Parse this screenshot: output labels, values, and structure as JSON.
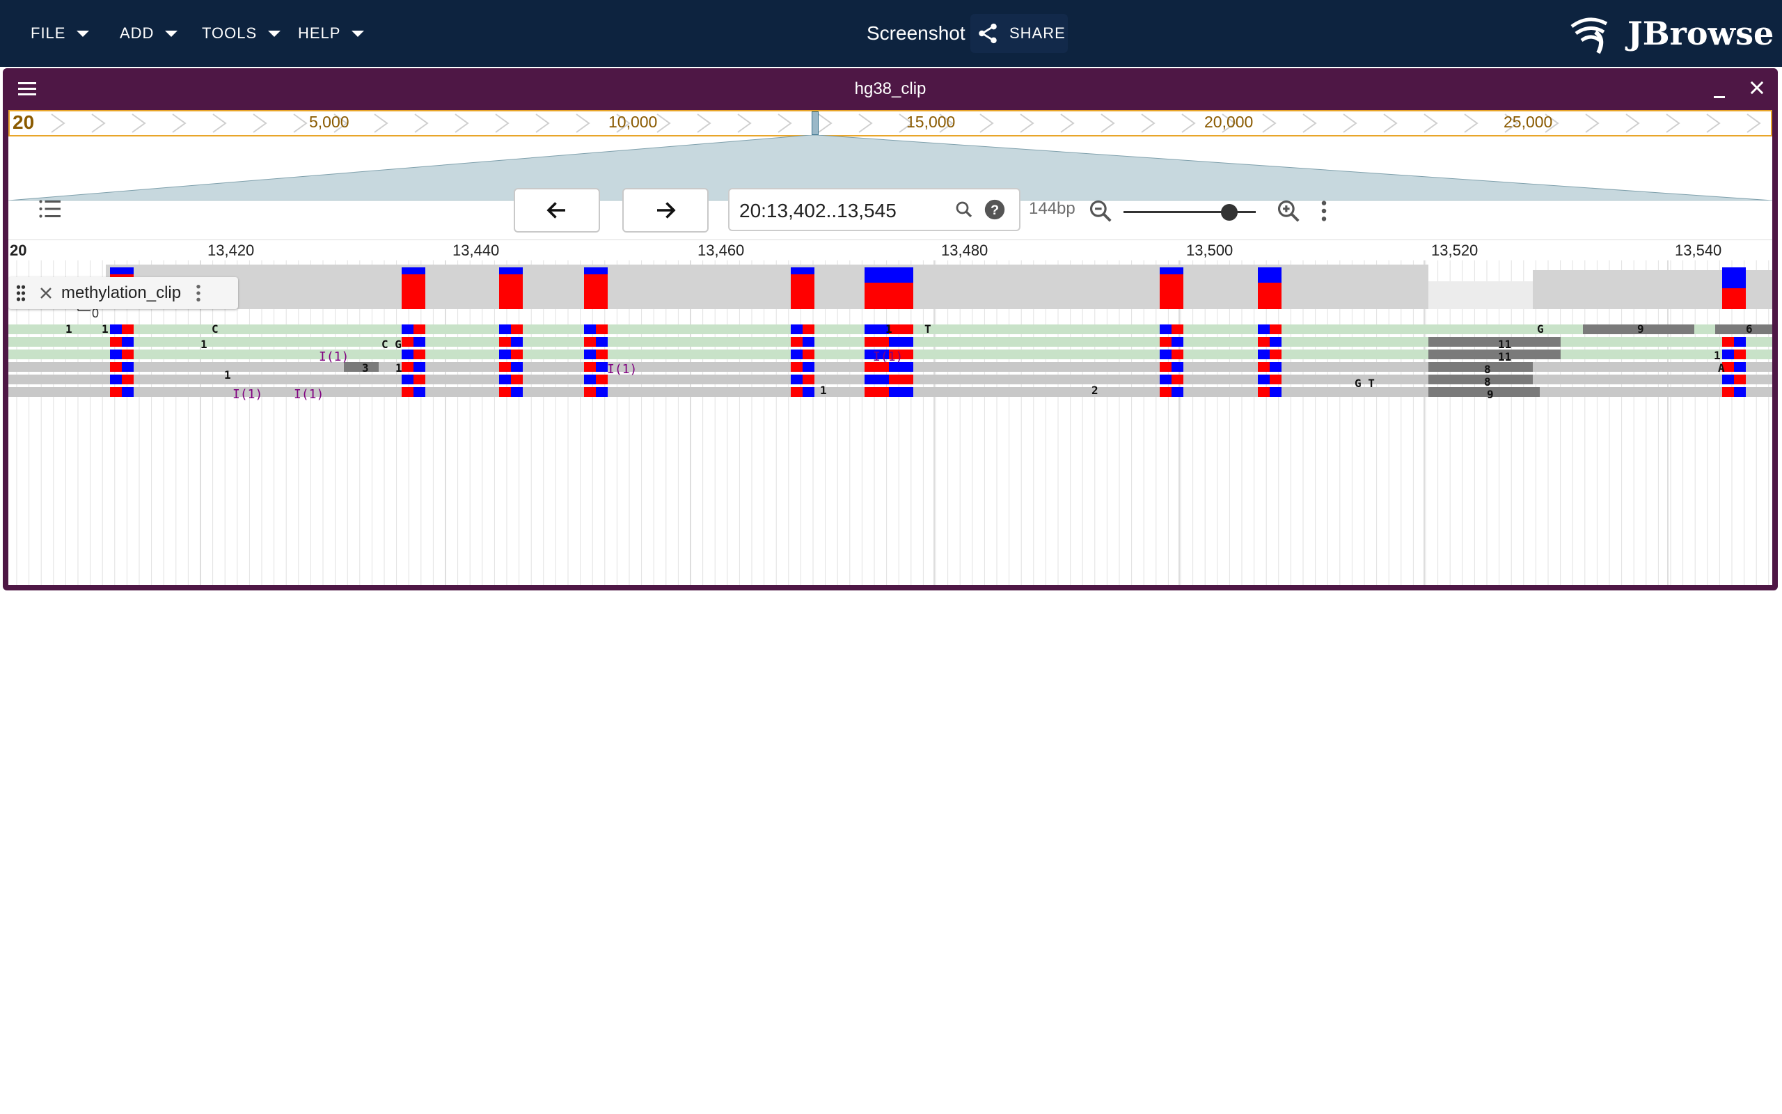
{
  "appbar": {
    "menus": [
      {
        "label": "FILE"
      },
      {
        "label": "ADD"
      },
      {
        "label": "TOOLS"
      },
      {
        "label": "HELP"
      }
    ],
    "session_title": "Screenshot",
    "share_label": "SHARE",
    "logo_text": "JBrowse"
  },
  "view": {
    "title": "hg38_clip",
    "overview": {
      "chromosome": "20",
      "labels": [
        "5,000",
        "10,000",
        "15,000",
        "20,000",
        "25,000"
      ]
    },
    "nav": {
      "location": "20:13,402..13,545",
      "bp_label": "144bp",
      "zoom_level": 0.78
    },
    "ruler": {
      "chromosome": "20",
      "ticks": [
        "13,420",
        "13,440",
        "13,460",
        "13,480",
        "13,500",
        "13,520",
        "13,540"
      ]
    },
    "track": {
      "name": "methylation_clip",
      "coverage_zero": "0",
      "insertion_label": "I(1)",
      "read_text": [
        "1",
        "1",
        "1",
        "C",
        "1",
        "C G",
        "3",
        "1",
        "1",
        "2",
        "1",
        "T",
        "G T",
        "11",
        "11",
        "8",
        "8",
        "9",
        "9",
        "G",
        "6",
        "A",
        "1"
      ]
    }
  },
  "colors": {
    "appbar": "#0d233f",
    "view_frame": "#4e1745",
    "methyl_red": "#ff0000",
    "methyl_blue": "#0000ff",
    "read_green": "#c8e2c8",
    "read_gray": "#c8c8c8",
    "coverage": "#d3d3d3",
    "overview_border": "#e8a52a"
  }
}
